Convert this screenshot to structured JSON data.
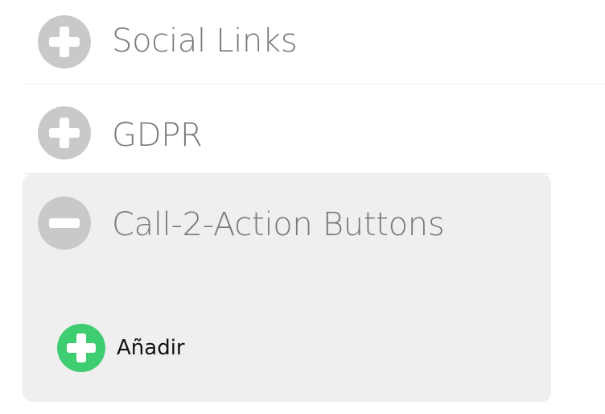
{
  "sections": [
    {
      "label": "Social Links",
      "state": "collapsed",
      "icon": "plus-circle-icon"
    },
    {
      "label": "GDPR",
      "state": "collapsed",
      "icon": "plus-circle-icon"
    },
    {
      "label": "Call-2-Action Buttons",
      "state": "expanded",
      "icon": "minus-circle-icon"
    }
  ],
  "add_button": {
    "label": "Añadir",
    "icon": "plus-circle-icon"
  },
  "colors": {
    "icon_gray": "#c9c9c9",
    "label_gray": "#7a7a7a",
    "panel_bg": "#efefef",
    "add_green": "#3fcd72"
  }
}
